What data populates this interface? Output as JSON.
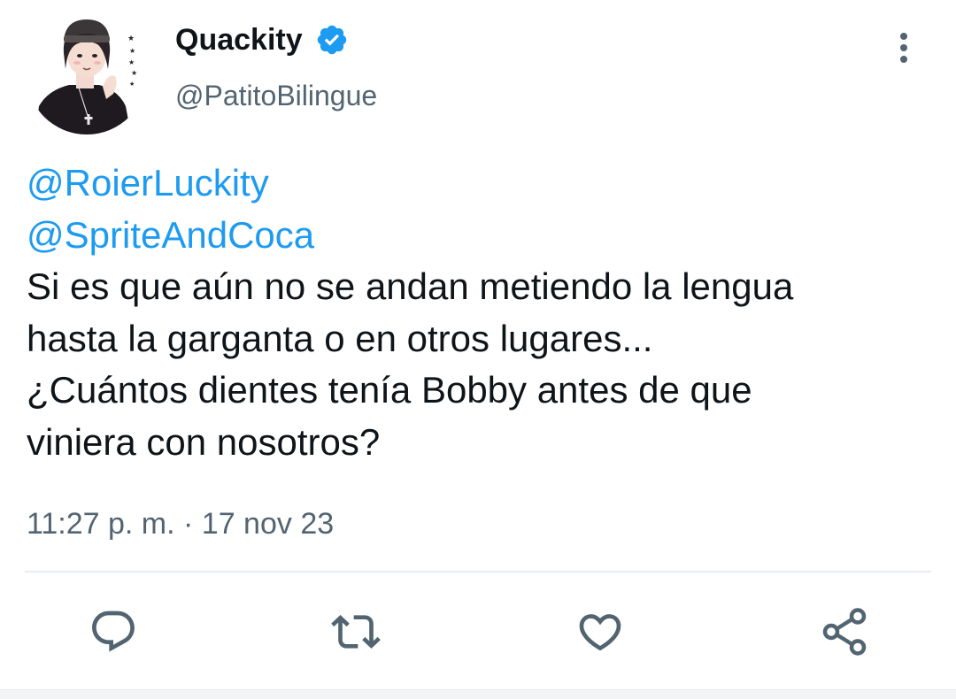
{
  "tweet": {
    "author": {
      "display_name": "Quackity",
      "handle": "@PatitoBilingue",
      "verified": true,
      "avatar": "avatar-illustration"
    },
    "mentions": [
      "@RoierLuckity",
      "@SpriteAndCoca"
    ],
    "text_lines": [
      "Si es que aún no se andan metiendo la lengua",
      "hasta la garganta o en otros lugares...",
      "¿Cuántos dientes tenía Bobby antes de que",
      "viniera con nosotros?"
    ],
    "timestamp": "11:27 p. m. · 17 nov 23"
  },
  "actions": {
    "reply_icon": "reply-icon",
    "retweet_icon": "retweet-icon",
    "like_icon": "heart-icon",
    "share_icon": "share-icon"
  },
  "colors": {
    "link": "#1d9bf0",
    "secondary_text": "#536471",
    "primary_text": "#0f1419",
    "verified_badge": "#1d9bf0",
    "icon": "#536471"
  }
}
